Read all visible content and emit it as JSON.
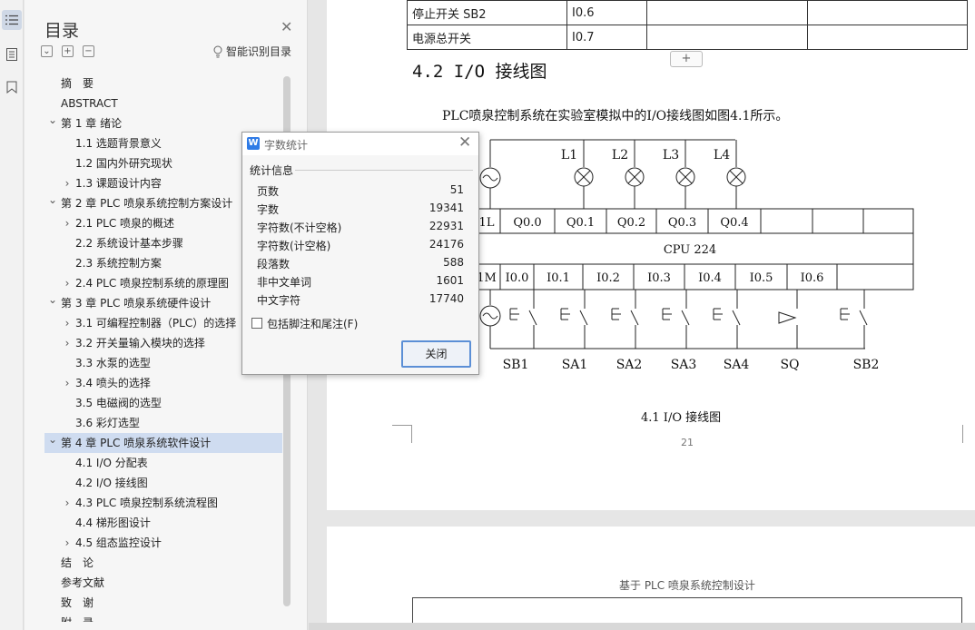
{
  "toc": {
    "title": "目录",
    "smart_label": "智能识别目录",
    "items": [
      {
        "label": "摘　要",
        "level": 1,
        "arrow": ""
      },
      {
        "label": "ABSTRACT",
        "level": 1,
        "arrow": ""
      },
      {
        "label": "第 1 章  绪论",
        "level": 1,
        "arrow": "expanded"
      },
      {
        "label": "1.1  选题背景意义",
        "level": 2,
        "arrow": ""
      },
      {
        "label": "1.2 国内外研究现状",
        "level": 2,
        "arrow": ""
      },
      {
        "label": "1.3  课题设计内容",
        "level": 2,
        "arrow": "collapsed"
      },
      {
        "label": "第 2 章  PLC 喷泉系统控制方案设计",
        "level": 1,
        "arrow": "expanded"
      },
      {
        "label": "2.1 PLC 喷泉的概述",
        "level": 2,
        "arrow": "collapsed"
      },
      {
        "label": "2.2 系统设计基本步骤",
        "level": 2,
        "arrow": ""
      },
      {
        "label": "2.3  系统控制方案",
        "level": 2,
        "arrow": ""
      },
      {
        "label": "2.4 PLC 喷泉控制系统的原理图",
        "level": 2,
        "arrow": "collapsed"
      },
      {
        "label": "第 3 章  PLC 喷泉系统硬件设计",
        "level": 1,
        "arrow": "expanded"
      },
      {
        "label": "3.1  可编程控制器（PLC）的选择",
        "level": 2,
        "arrow": "collapsed"
      },
      {
        "label": "3.2  开关量输入模块的选择",
        "level": 2,
        "arrow": "collapsed"
      },
      {
        "label": "3.3  水泵的选型",
        "level": 2,
        "arrow": ""
      },
      {
        "label": "3.4  喷头的选择",
        "level": 2,
        "arrow": "collapsed"
      },
      {
        "label": "3.5  电磁阀的选型",
        "level": 2,
        "arrow": ""
      },
      {
        "label": "3.6  彩灯选型",
        "level": 2,
        "arrow": ""
      },
      {
        "label": "第 4 章  PLC 喷泉系统软件设计",
        "level": 1,
        "arrow": "expanded",
        "selected": true
      },
      {
        "label": "4.1 I/O 分配表",
        "level": 2,
        "arrow": ""
      },
      {
        "label": "4.2 I/O 接线图",
        "level": 2,
        "arrow": ""
      },
      {
        "label": "4.3 PLC 喷泉控制系统流程图",
        "level": 2,
        "arrow": "collapsed"
      },
      {
        "label": "4.4  梯形图设计",
        "level": 2,
        "arrow": ""
      },
      {
        "label": "4.5  组态监控设计",
        "level": 2,
        "arrow": "collapsed"
      },
      {
        "label": "结　论",
        "level": 1,
        "arrow": ""
      },
      {
        "label": "参考文献",
        "level": 1,
        "arrow": ""
      },
      {
        "label": "致　谢",
        "level": 1,
        "arrow": ""
      },
      {
        "label": "附　录",
        "level": 1,
        "arrow": ""
      }
    ]
  },
  "doc": {
    "table_rows": [
      [
        "停止开关 SB2",
        "I0.6",
        "",
        ""
      ],
      [
        "电源总开关",
        "I0.7",
        "",
        ""
      ]
    ],
    "add_row_label": "+",
    "heading": "4.2 I/O 接线图",
    "intro": "PLC喷泉控制系统在实验室模拟中的I/O接线图如图4.1所示。",
    "caption": "4.1  I/O 接线图",
    "page_number": "21",
    "page2_header": "基于 PLC 喷泉系统控制设计"
  },
  "diagram": {
    "lamps": [
      "L1",
      "L2",
      "L3",
      "L4"
    ],
    "output_cells": [
      "1L",
      "Q0.0",
      "Q0.1",
      "Q0.2",
      "Q0.3",
      "Q0.4",
      "",
      "",
      ""
    ],
    "cpu_label": "CPU 224",
    "input_cells": [
      "1M",
      "I0.0",
      "I0.1",
      "I0.2",
      "I0.3",
      "I0.4",
      "I0.5",
      "I0.6"
    ],
    "switches": [
      "SB1",
      "SA1",
      "SA2",
      "SA3",
      "SA4",
      "SQ",
      "SB2"
    ]
  },
  "dialog": {
    "title": "字数统计",
    "section": "统计信息",
    "stats": [
      {
        "label": "页数",
        "value": "51"
      },
      {
        "label": "字数",
        "value": "19341"
      },
      {
        "label": "字符数(不计空格)",
        "value": "22931"
      },
      {
        "label": "字符数(计空格)",
        "value": "24176"
      },
      {
        "label": "段落数",
        "value": "588"
      },
      {
        "label": "非中文单词",
        "value": "1601"
      },
      {
        "label": "中文字符",
        "value": "17740"
      }
    ],
    "checkbox_label": "包括脚注和尾注(F)",
    "close_label": "关闭"
  },
  "colors": {
    "selection": "#cfdcf0",
    "button_border": "#5b8fd6",
    "wps_blue": "#2f7be6"
  }
}
